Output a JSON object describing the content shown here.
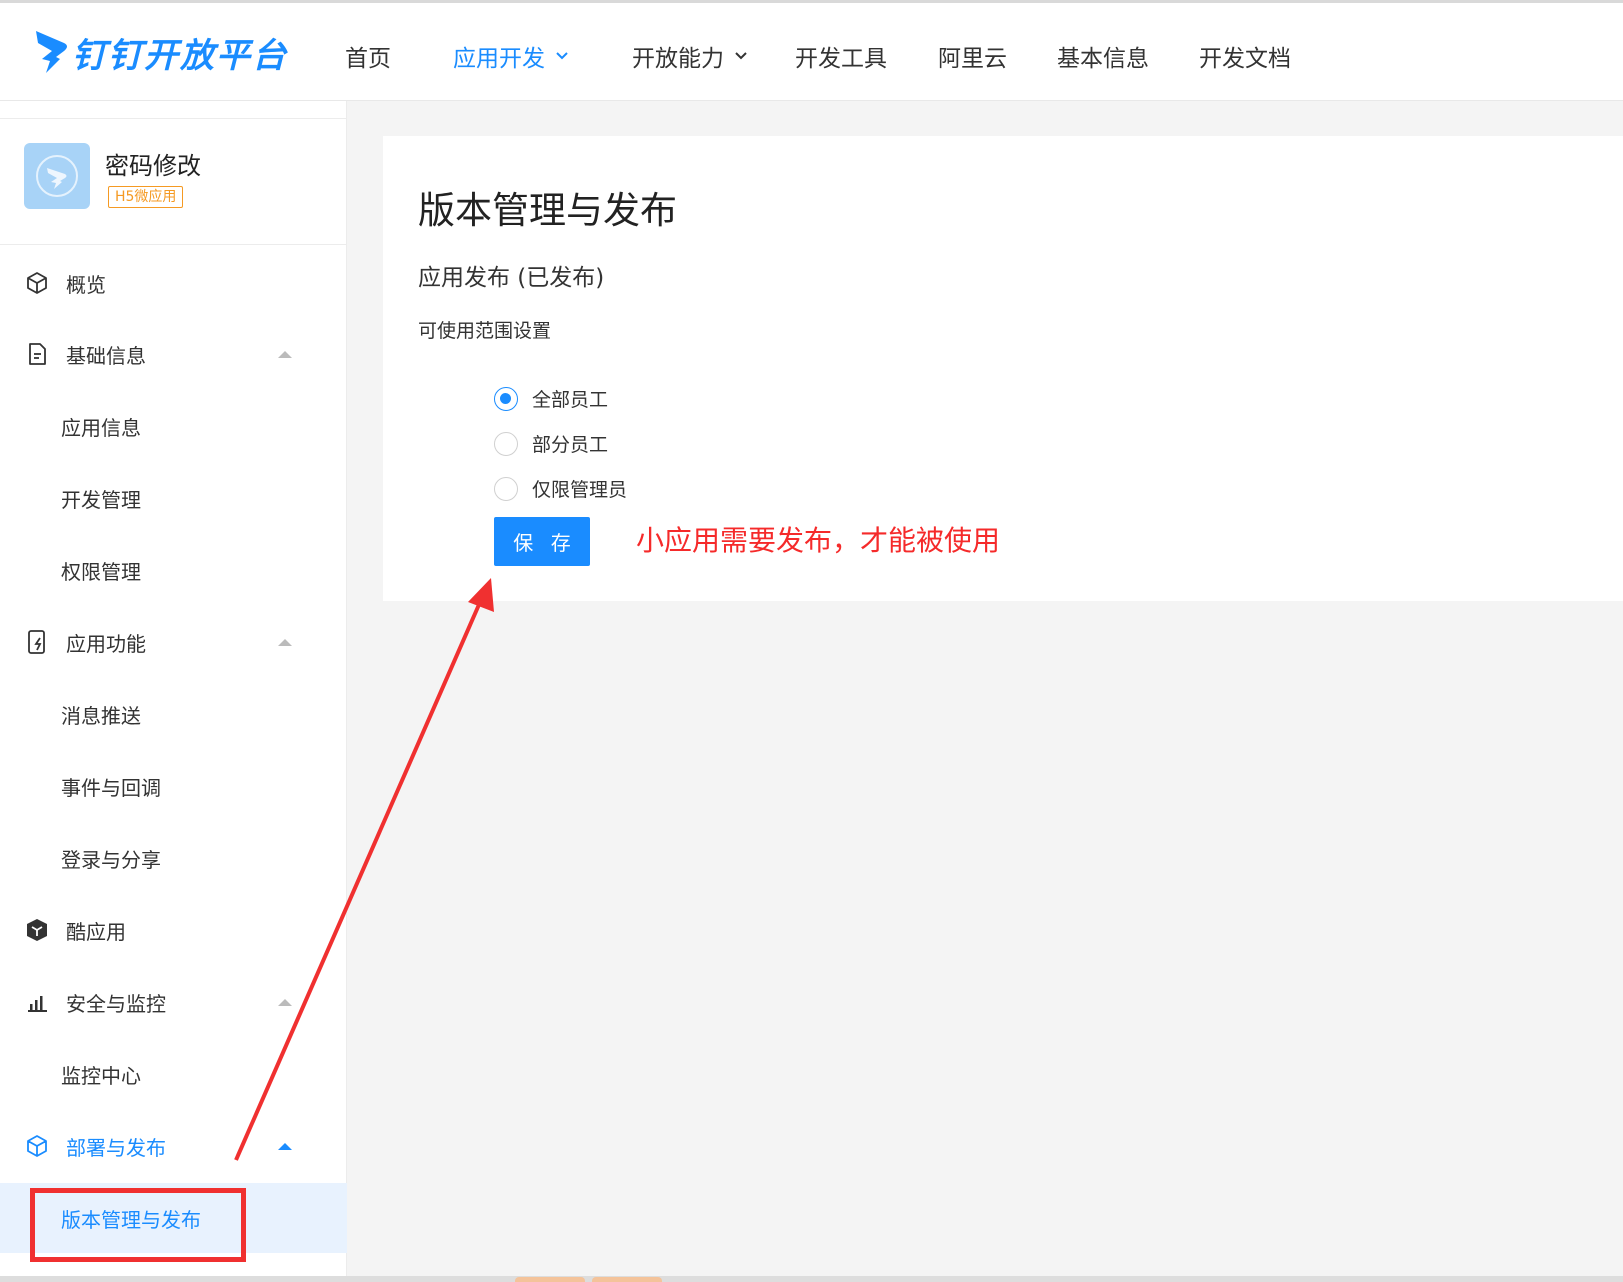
{
  "brand": {
    "name": "钉钉开放平台",
    "color": "#1a8cff"
  },
  "topnav": [
    {
      "label": "首页"
    },
    {
      "label": "应用开发",
      "active": true,
      "has_dropdown": true
    },
    {
      "label": "开放能力",
      "has_dropdown": true
    },
    {
      "label": "开发工具"
    },
    {
      "label": "阿里云"
    },
    {
      "label": "基本信息"
    },
    {
      "label": "开发文档"
    }
  ],
  "app": {
    "name": "密码修改",
    "badge": "H5微应用"
  },
  "sidebar": [
    {
      "label": "概览",
      "icon": "cube-icon"
    },
    {
      "label": "基础信息",
      "icon": "document-icon",
      "expanded": true
    },
    {
      "label": "应用信息"
    },
    {
      "label": "开发管理"
    },
    {
      "label": "权限管理"
    },
    {
      "label": "应用功能",
      "icon": "phone-bolt-icon",
      "expanded": true
    },
    {
      "label": "消息推送"
    },
    {
      "label": "事件与回调"
    },
    {
      "label": "登录与分享"
    },
    {
      "label": "酷应用",
      "icon": "cool-app-icon"
    },
    {
      "label": "安全与监控",
      "icon": "bar-chart-icon",
      "expanded": true
    },
    {
      "label": "监控中心"
    },
    {
      "label": "部署与发布",
      "icon": "cube-icon",
      "expanded": true,
      "active": true
    },
    {
      "label": "版本管理与发布",
      "selected": true
    }
  ],
  "main": {
    "title": "版本管理与发布",
    "section": "应用发布 (已发布)",
    "scope_label": "可使用范围设置",
    "options": [
      {
        "label": "全部员工",
        "checked": true
      },
      {
        "label": "部分员工",
        "checked": false
      },
      {
        "label": "仅限管理员",
        "checked": false
      }
    ],
    "save_label": "保 存"
  },
  "annotation": {
    "note": "小应用需要发布，才能被使用",
    "color": "#f03030"
  }
}
